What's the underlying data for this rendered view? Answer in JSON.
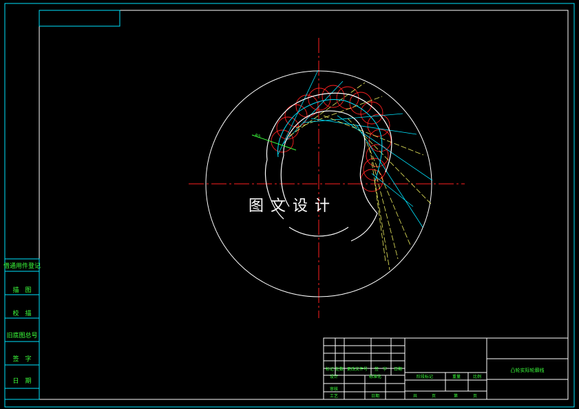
{
  "drawing": {
    "watermark": "图文设计",
    "dimension_label": "R5",
    "colors": {
      "background": "#000000",
      "frame": "#00e5ff",
      "outline": "#ffffff",
      "centerline": "#ff2020",
      "roller": "#ff2020",
      "rays_cyan": "#00e5ff",
      "rays_yellow": "#f0f060",
      "dimension": "#3cff3c",
      "label_text": "#3cff3c"
    }
  },
  "side_stamps": [
    "借通用件登记",
    "描　图",
    "校　描",
    "旧底图总号",
    "签　字",
    "日　期"
  ],
  "title_block": {
    "drawing_title": "凸轮实际轮廓线",
    "revision_headers": [
      "标记",
      "处数",
      "更改文件号",
      "签　字",
      "日期"
    ],
    "role_labels": [
      "设计",
      "标准化",
      "审核",
      "工艺",
      "日期"
    ],
    "stage_headers": [
      "阶段标记",
      "重量",
      "比例"
    ],
    "sheet_labels": [
      "共",
      "页",
      "第",
      "页"
    ]
  }
}
